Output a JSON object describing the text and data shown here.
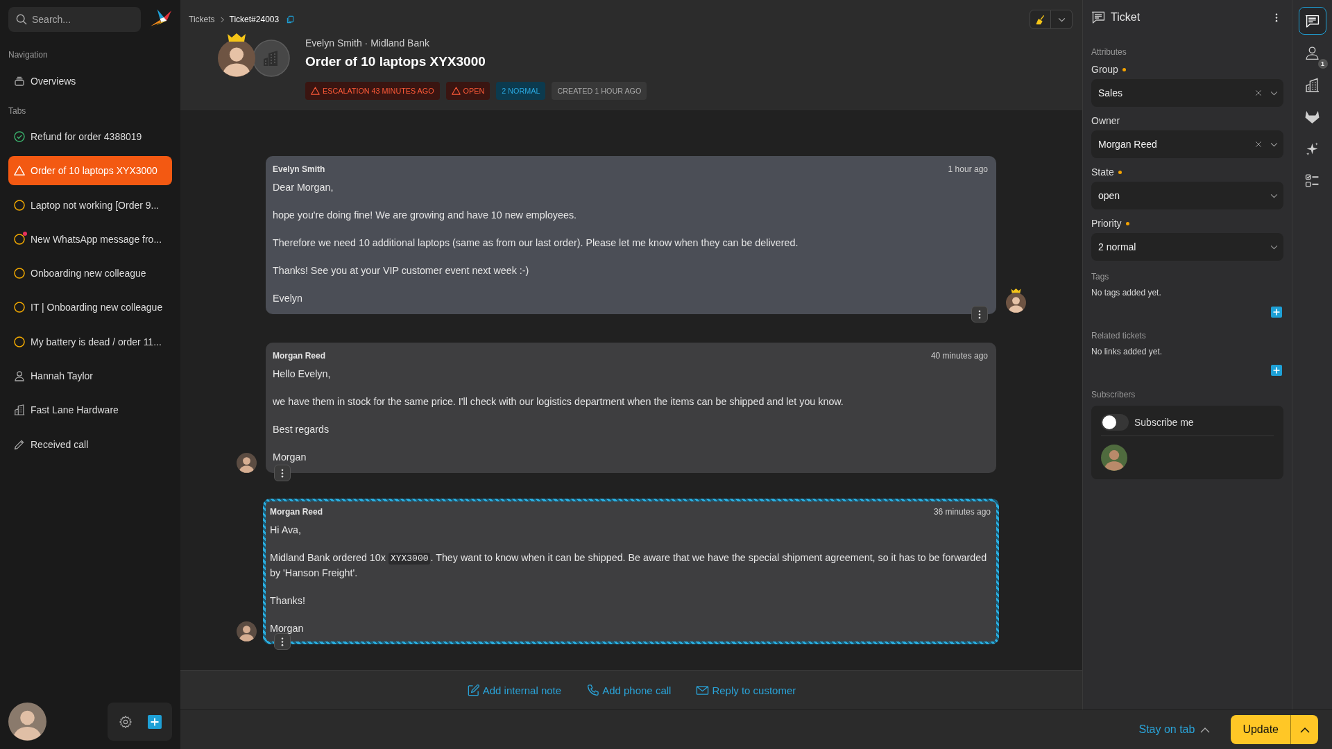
{
  "sidebar": {
    "search": {
      "placeholder": "Search..."
    },
    "navigation": {
      "title": "Navigation",
      "items": [
        {
          "label": "Overviews",
          "selected": false
        }
      ]
    },
    "tabs": {
      "title": "Tabs",
      "items": [
        {
          "kind": "closed",
          "label": "Refund for order 4388019",
          "selected": false,
          "unread": false
        },
        {
          "kind": "escalated",
          "label": "Order of 10 laptops XYX3000",
          "selected": true,
          "unread": false
        },
        {
          "kind": "open",
          "label": "Laptop not working [Order 9...",
          "selected": false,
          "unread": false
        },
        {
          "kind": "open",
          "label": "New WhatsApp message fro...",
          "selected": false,
          "unread": true
        },
        {
          "kind": "open",
          "label": "Onboarding new colleague",
          "selected": false,
          "unread": false
        },
        {
          "kind": "open",
          "label": "IT | Onboarding new colleague",
          "selected": false,
          "unread": false
        },
        {
          "kind": "open",
          "label": "My battery is dead / order 11...",
          "selected": false,
          "unread": false
        },
        {
          "kind": "user",
          "label": "Hannah Taylor",
          "selected": false,
          "unread": false
        },
        {
          "kind": "organization",
          "label": "Fast Lane Hardware",
          "selected": false,
          "unread": false
        },
        {
          "kind": "draft",
          "label": "Received call",
          "selected": false,
          "unread": false
        }
      ]
    }
  },
  "header": {
    "breadcrumbs": [
      {
        "label": "Tickets"
      },
      {
        "label": "Ticket#24003"
      }
    ],
    "customer_vip": true,
    "subtitle": "Evelyn Smith · Midland Bank",
    "title": "Order of 10 laptops XYX3000",
    "badges": [
      {
        "kind": "escalation",
        "label": "ESCALATION 43 MINUTES AGO"
      },
      {
        "kind": "state",
        "label": "OPEN"
      },
      {
        "kind": "priority",
        "label": "2 NORMAL"
      },
      {
        "kind": "created",
        "label": "CREATED 1 HOUR AGO"
      }
    ]
  },
  "messages": [
    {
      "kind": "customer",
      "internal": false,
      "author": "Evelyn Smith",
      "time": "1 hour ago",
      "paragraphs": [
        [
          {
            "text": "Dear Morgan,",
            "code": false
          }
        ],
        [
          {
            "text": "hope you're doing fine! We are growing and have 10 new employees.",
            "code": false
          }
        ],
        [
          {
            "text": "Therefore we need 10 additional laptops (same as from our last order). Please let me know when they can be delivered.",
            "code": false
          }
        ],
        [
          {
            "text": "Thanks! See you at your VIP customer event next week :-)",
            "code": false
          }
        ],
        [
          {
            "text": "Evelyn",
            "code": false
          }
        ]
      ]
    },
    {
      "kind": "agent",
      "internal": false,
      "author": "Morgan Reed",
      "time": "40 minutes ago",
      "paragraphs": [
        [
          {
            "text": "Hello Evelyn,",
            "code": false
          }
        ],
        [
          {
            "text": "we have them in stock for the same price. I'll check with our logistics department when the items can be shipped and let you know.",
            "code": false
          }
        ],
        [
          {
            "text": "Best regards",
            "code": false
          }
        ],
        [
          {
            "text": "Morgan",
            "code": false
          }
        ]
      ]
    },
    {
      "kind": "agent",
      "internal": true,
      "author": "Morgan Reed",
      "time": "36 minutes ago",
      "paragraphs": [
        [
          {
            "text": "Hi Ava,",
            "code": false
          }
        ],
        [
          {
            "text": "Midland Bank ordered 10x ",
            "code": false
          },
          {
            "text": "XYX3000",
            "code": true
          },
          {
            "text": ". They want to know when it can be shipped. Be aware that we have the special shipment agreement, so it has to be forwarded by 'Hanson Freight'.",
            "code": false
          }
        ],
        [
          {
            "text": "Thanks!",
            "code": false
          }
        ],
        [
          {
            "text": "Morgan",
            "code": false
          }
        ]
      ]
    }
  ],
  "composer_actions": [
    {
      "kind": "note",
      "label": "Add internal note"
    },
    {
      "kind": "phone",
      "label": "Add phone call"
    },
    {
      "kind": "email",
      "label": "Reply to customer"
    }
  ],
  "ticket_panel": {
    "title": "Ticket",
    "section_title": "Attributes",
    "fields": [
      {
        "label": "Group",
        "required": true,
        "value": "Sales",
        "clearable": true
      },
      {
        "label": "Owner",
        "required": false,
        "value": "Morgan Reed",
        "clearable": true
      },
      {
        "label": "State",
        "required": true,
        "value": "open",
        "clearable": false
      },
      {
        "label": "Priority",
        "required": true,
        "value": "2 normal",
        "clearable": false
      }
    ],
    "tags": {
      "title": "Tags",
      "empty_text": "No tags added yet."
    },
    "related": {
      "title": "Related tickets",
      "empty_text": "No links added yet."
    },
    "subscribers": {
      "title": "Subscribers",
      "toggle_label": "Subscribe me",
      "on": false
    }
  },
  "panel_tabs": [
    {
      "kind": "ticket",
      "selected": true
    },
    {
      "kind": "customer",
      "selected": false,
      "badge": "1"
    },
    {
      "kind": "organization",
      "selected": false
    },
    {
      "kind": "integration",
      "selected": false
    },
    {
      "kind": "ai",
      "selected": false
    },
    {
      "kind": "checklist",
      "selected": false
    }
  ],
  "footer": {
    "stay_on_tab": "Stay on tab",
    "update": "Update"
  }
}
